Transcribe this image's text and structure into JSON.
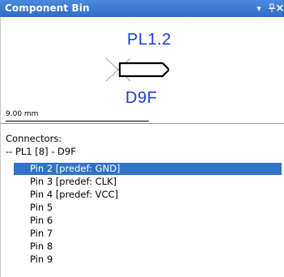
{
  "panel": {
    "title": "Component Bin",
    "menu_glyph": "▾",
    "pin_glyph": "⊥",
    "close_glyph": "×"
  },
  "preview": {
    "reference": "PL1.2",
    "value": "D9F",
    "scale": "9.00 mm",
    "symbol_icon": "connector-pin-symbol",
    "label_color": "#1a3cd8"
  },
  "list": {
    "heading": "Connectors:",
    "group": "-- PL1 [8] - D9F",
    "pins": [
      "Pin 2 [predef: GND]",
      "Pin 3 [predef: CLK]",
      "Pin 4 [predef: VCC]",
      "Pin 5",
      "Pin 6",
      "Pin 7",
      "Pin 8",
      "Pin 9"
    ],
    "selected_index": 0,
    "selection_color": "#2f73c9"
  }
}
